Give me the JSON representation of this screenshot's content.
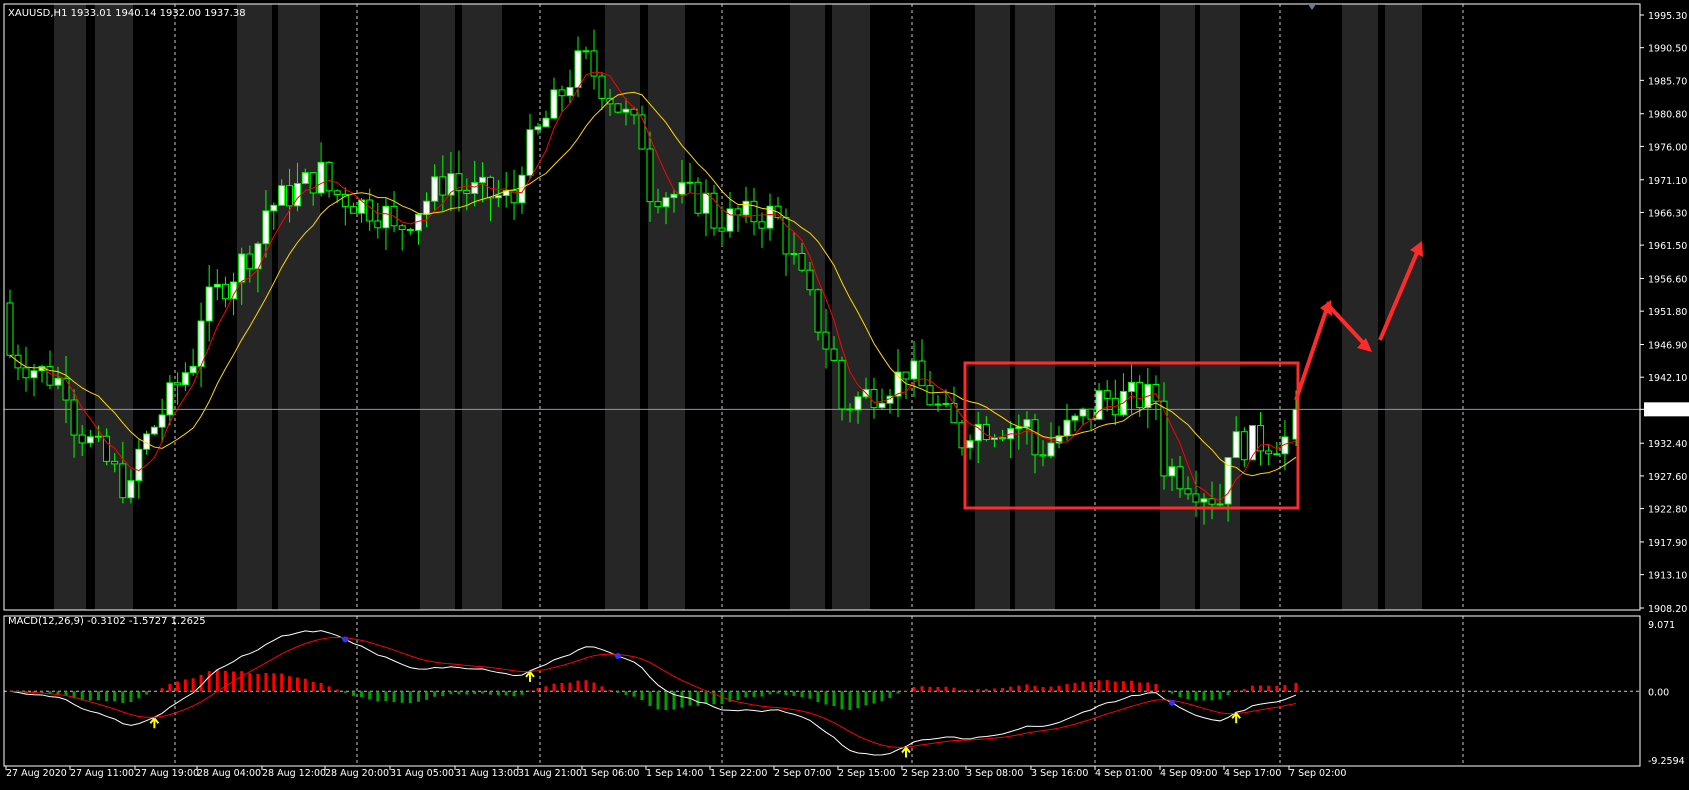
{
  "header": {
    "symbol_info": "XAUUSD,H1  1933.01 1940.14 1932.00 1937.38"
  },
  "macd_header": "MACD(12,26,9) -0.3102 -1.5727 1.2625",
  "colors": {
    "background": "#000000",
    "band": "#262626",
    "bull_candle": "#ffffff",
    "bear_candle": "#00ff00",
    "wick": "#00ff00",
    "ma_fast": "#ff0000",
    "ma_slow": "#ffd700",
    "grid": "#c8c8c8",
    "annotation": "#ff2a2a",
    "macd_line": "#ffffff",
    "signal_line": "#ff0000",
    "hist_pos": "#ff0000",
    "hist_neg": "#00a000",
    "arrow_up": "#ffff00",
    "cross_dot": "#3333ff"
  },
  "price_axis_labels": [
    "1995.30",
    "1990.50",
    "1985.70",
    "1980.80",
    "1976.00",
    "1971.10",
    "1966.30",
    "1961.50",
    "1956.60",
    "1951.80",
    "1946.90",
    "1942.10",
    "1937.38",
    "1932.40",
    "1927.60",
    "1922.80",
    "1917.90",
    "1913.10",
    "1908.20"
  ],
  "macd_axis_labels": [
    "9.071",
    "0.00",
    "-9.2594"
  ],
  "time_axis_labels": [
    "27 Aug 2020",
    "27 Aug 11:00",
    "27 Aug 19:00",
    "28 Aug 04:00",
    "28 Aug 12:00",
    "28 Aug 20:00",
    "31 Aug 05:00",
    "31 Aug 13:00",
    "31 Aug 21:00",
    "1 Sep 06:00",
    "1 Sep 14:00",
    "1 Sep 22:00",
    "2 Sep 07:00",
    "2 Sep 15:00",
    "2 Sep 23:00",
    "3 Sep 08:00",
    "3 Sep 16:00",
    "4 Sep 01:00",
    "4 Sep 09:00",
    "4 Sep 17:00",
    "7 Sep 02:00"
  ],
  "chart_data": [
    {
      "type": "candlestick",
      "symbol": "XAUUSD",
      "timeframe": "H1",
      "last_price": 1937.38,
      "ylim": [
        1908.2,
        1995.3
      ],
      "ohlc_keypoints": [
        [
          "27 Aug 2020",
          1953.0,
          1946.0
        ],
        [
          "27 Aug 11:00",
          1941.0,
          1937.0
        ],
        [
          "27 Aug 19:00",
          1925.0,
          1929.0
        ],
        [
          "28 Aug 04:00",
          1945.0,
          1950.0
        ],
        [
          "28 Aug 12:00",
          1962.0,
          1966.0
        ],
        [
          "28 Aug 20:00",
          1972.0,
          1970.0
        ],
        [
          "31 Aug 05:00",
          1966.0,
          1962.0
        ],
        [
          "31 Aug 13:00",
          1972.0,
          1970.0
        ],
        [
          "31 Aug 21:00",
          1968.0,
          1972.0
        ],
        [
          "1 Sep 06:00",
          1988.0,
          1990.0
        ],
        [
          "1 Sep 14:00",
          1977.0,
          1970.0
        ],
        [
          "1 Sep 22:00",
          1968.0,
          1965.0
        ],
        [
          "2 Sep 07:00",
          1966.0,
          1968.0
        ],
        [
          "2 Sep 15:00",
          1944.0,
          1937.0
        ],
        [
          "2 Sep 23:00",
          1942.0,
          1945.0
        ],
        [
          "3 Sep 08:00",
          1933.0,
          1935.0
        ],
        [
          "3 Sep 16:00",
          1935.0,
          1930.0
        ],
        [
          "4 Sep 01:00",
          1937.0,
          1939.0
        ],
        [
          "4 Sep 09:00",
          1939.0,
          1930.0
        ],
        [
          "4 Sep 17:00",
          1924.0,
          1932.0
        ],
        [
          "7 Sep 02:00",
          1933.01,
          1937.38
        ]
      ],
      "indicators": [
        "moving average (red)",
        "moving average (yellow)"
      ],
      "grid": true
    },
    {
      "type": "macd",
      "label": "MACD(12,26,9)",
      "values": {
        "macd": -0.3102,
        "signal": -1.5727,
        "histogram": 1.2625
      },
      "ylim": [
        -9.2594,
        9.071
      ],
      "grid": true
    }
  ]
}
